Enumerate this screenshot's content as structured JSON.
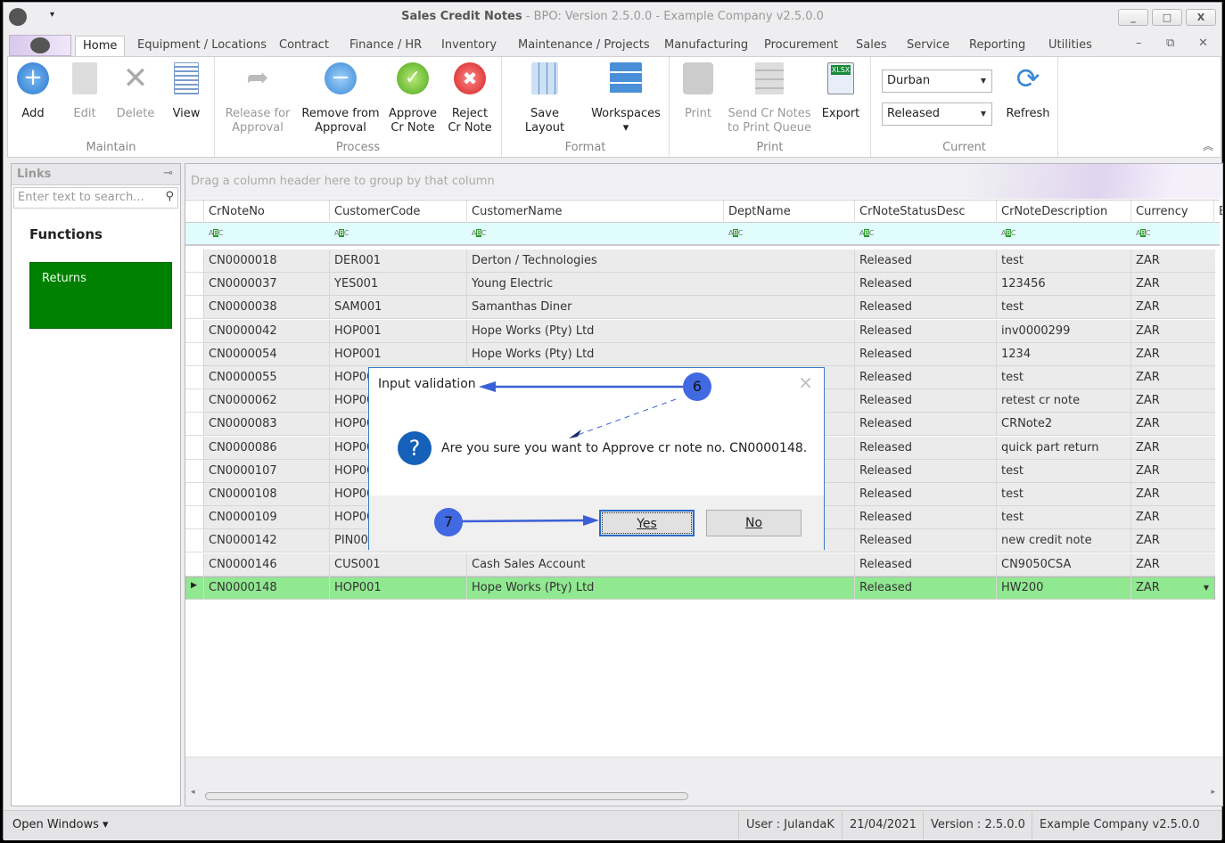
{
  "window": {
    "title": "Sales Credit Notes",
    "subtitle": " - BPO: Version 2.5.0.0 - Example Company v2.5.0.0",
    "minimize": "_",
    "maximize": "□",
    "close": "X"
  },
  "tabs": [
    "Home",
    "Equipment / Locations",
    "Contract",
    "Finance / HR",
    "Inventory",
    "Maintenance / Projects",
    "Manufacturing",
    "Procurement",
    "Sales",
    "Service",
    "Reporting",
    "Utilities"
  ],
  "ribbon": {
    "groups": {
      "maintain": "Maintain",
      "process": "Process",
      "format": "Format",
      "print": "Print",
      "current": "Current"
    },
    "add": "Add",
    "edit": "Edit",
    "delete": "Delete",
    "view": "View",
    "release": [
      "Release for",
      "Approval"
    ],
    "remove": [
      "Remove from",
      "Approval"
    ],
    "approve": [
      "Approve",
      "Cr Note"
    ],
    "reject": [
      "Reject",
      "Cr Note"
    ],
    "save_layout": "Save Layout",
    "workspaces": "Workspaces",
    "print": "Print",
    "send": [
      "Send Cr Notes",
      "to Print Queue"
    ],
    "export": "Export",
    "branch": "Durban",
    "status_filter": "Released",
    "refresh": "Refresh"
  },
  "links": {
    "title": "Links",
    "search_placeholder": "Enter text to search...",
    "functions": "Functions",
    "returns": "Returns"
  },
  "grid": {
    "group_hint": "Drag a column header here to group by that column",
    "columns": [
      "CrNoteNo",
      "CustomerCode",
      "CustomerName",
      "DeptName",
      "CrNoteStatusDesc",
      "CrNoteDescription",
      "Currency",
      "E"
    ],
    "rows": [
      [
        "CN0000018",
        "DER001",
        "Derton / Technologies",
        "",
        "Released",
        "test",
        "ZAR"
      ],
      [
        "CN0000037",
        "YES001",
        "Young Electric",
        "",
        "Released",
        "123456",
        "ZAR"
      ],
      [
        "CN0000038",
        "SAM001",
        "Samanthas Diner",
        "",
        "Released",
        "test",
        "ZAR"
      ],
      [
        "CN0000042",
        "HOP001",
        "Hope Works (Pty) Ltd",
        "",
        "Released",
        "inv0000299",
        "ZAR"
      ],
      [
        "CN0000054",
        "HOP001",
        "Hope Works (Pty) Ltd",
        "",
        "Released",
        "1234",
        "ZAR"
      ],
      [
        "CN0000055",
        "HOP00",
        "",
        "",
        "Released",
        "test",
        "ZAR"
      ],
      [
        "CN0000062",
        "HOP00",
        "",
        "",
        "Released",
        "retest cr note",
        "ZAR"
      ],
      [
        "CN0000083",
        "HOP00",
        "",
        "",
        "Released",
        "CRNote2",
        "ZAR"
      ],
      [
        "CN0000086",
        "HOP00",
        "",
        "",
        "Released",
        "quick part return",
        "ZAR"
      ],
      [
        "CN0000107",
        "HOP00",
        "",
        "",
        "Released",
        "test",
        "ZAR"
      ],
      [
        "CN0000108",
        "HOP00",
        "",
        "",
        "Released",
        "test",
        "ZAR"
      ],
      [
        "CN0000109",
        "HOP00",
        "",
        "",
        "Released",
        "test",
        "ZAR"
      ],
      [
        "CN0000142",
        "PIN000",
        "",
        "",
        "Released",
        "new credit note",
        "ZAR"
      ],
      [
        "CN0000146",
        "CUS001",
        "Cash Sales Account",
        "",
        "Released",
        "CN9050CSA",
        "ZAR"
      ],
      [
        "CN0000148",
        "HOP001",
        "Hope Works (Pty) Ltd",
        "",
        "Released",
        "HW200",
        "ZAR"
      ]
    ],
    "selected_row": 14
  },
  "dialog": {
    "title": "Input validation",
    "message": "Are you sure you want to Approve cr note no. CN0000148.",
    "yes": "Yes",
    "no": "No",
    "close": "×"
  },
  "annotations": {
    "step6": "6",
    "step7": "7"
  },
  "statusbar": {
    "open_windows": "Open Windows ▾",
    "user": "User : JulandaK",
    "date": "21/04/2021",
    "version": "Version : 2.5.0.0",
    "company": "Example Company v2.5.0.0"
  }
}
